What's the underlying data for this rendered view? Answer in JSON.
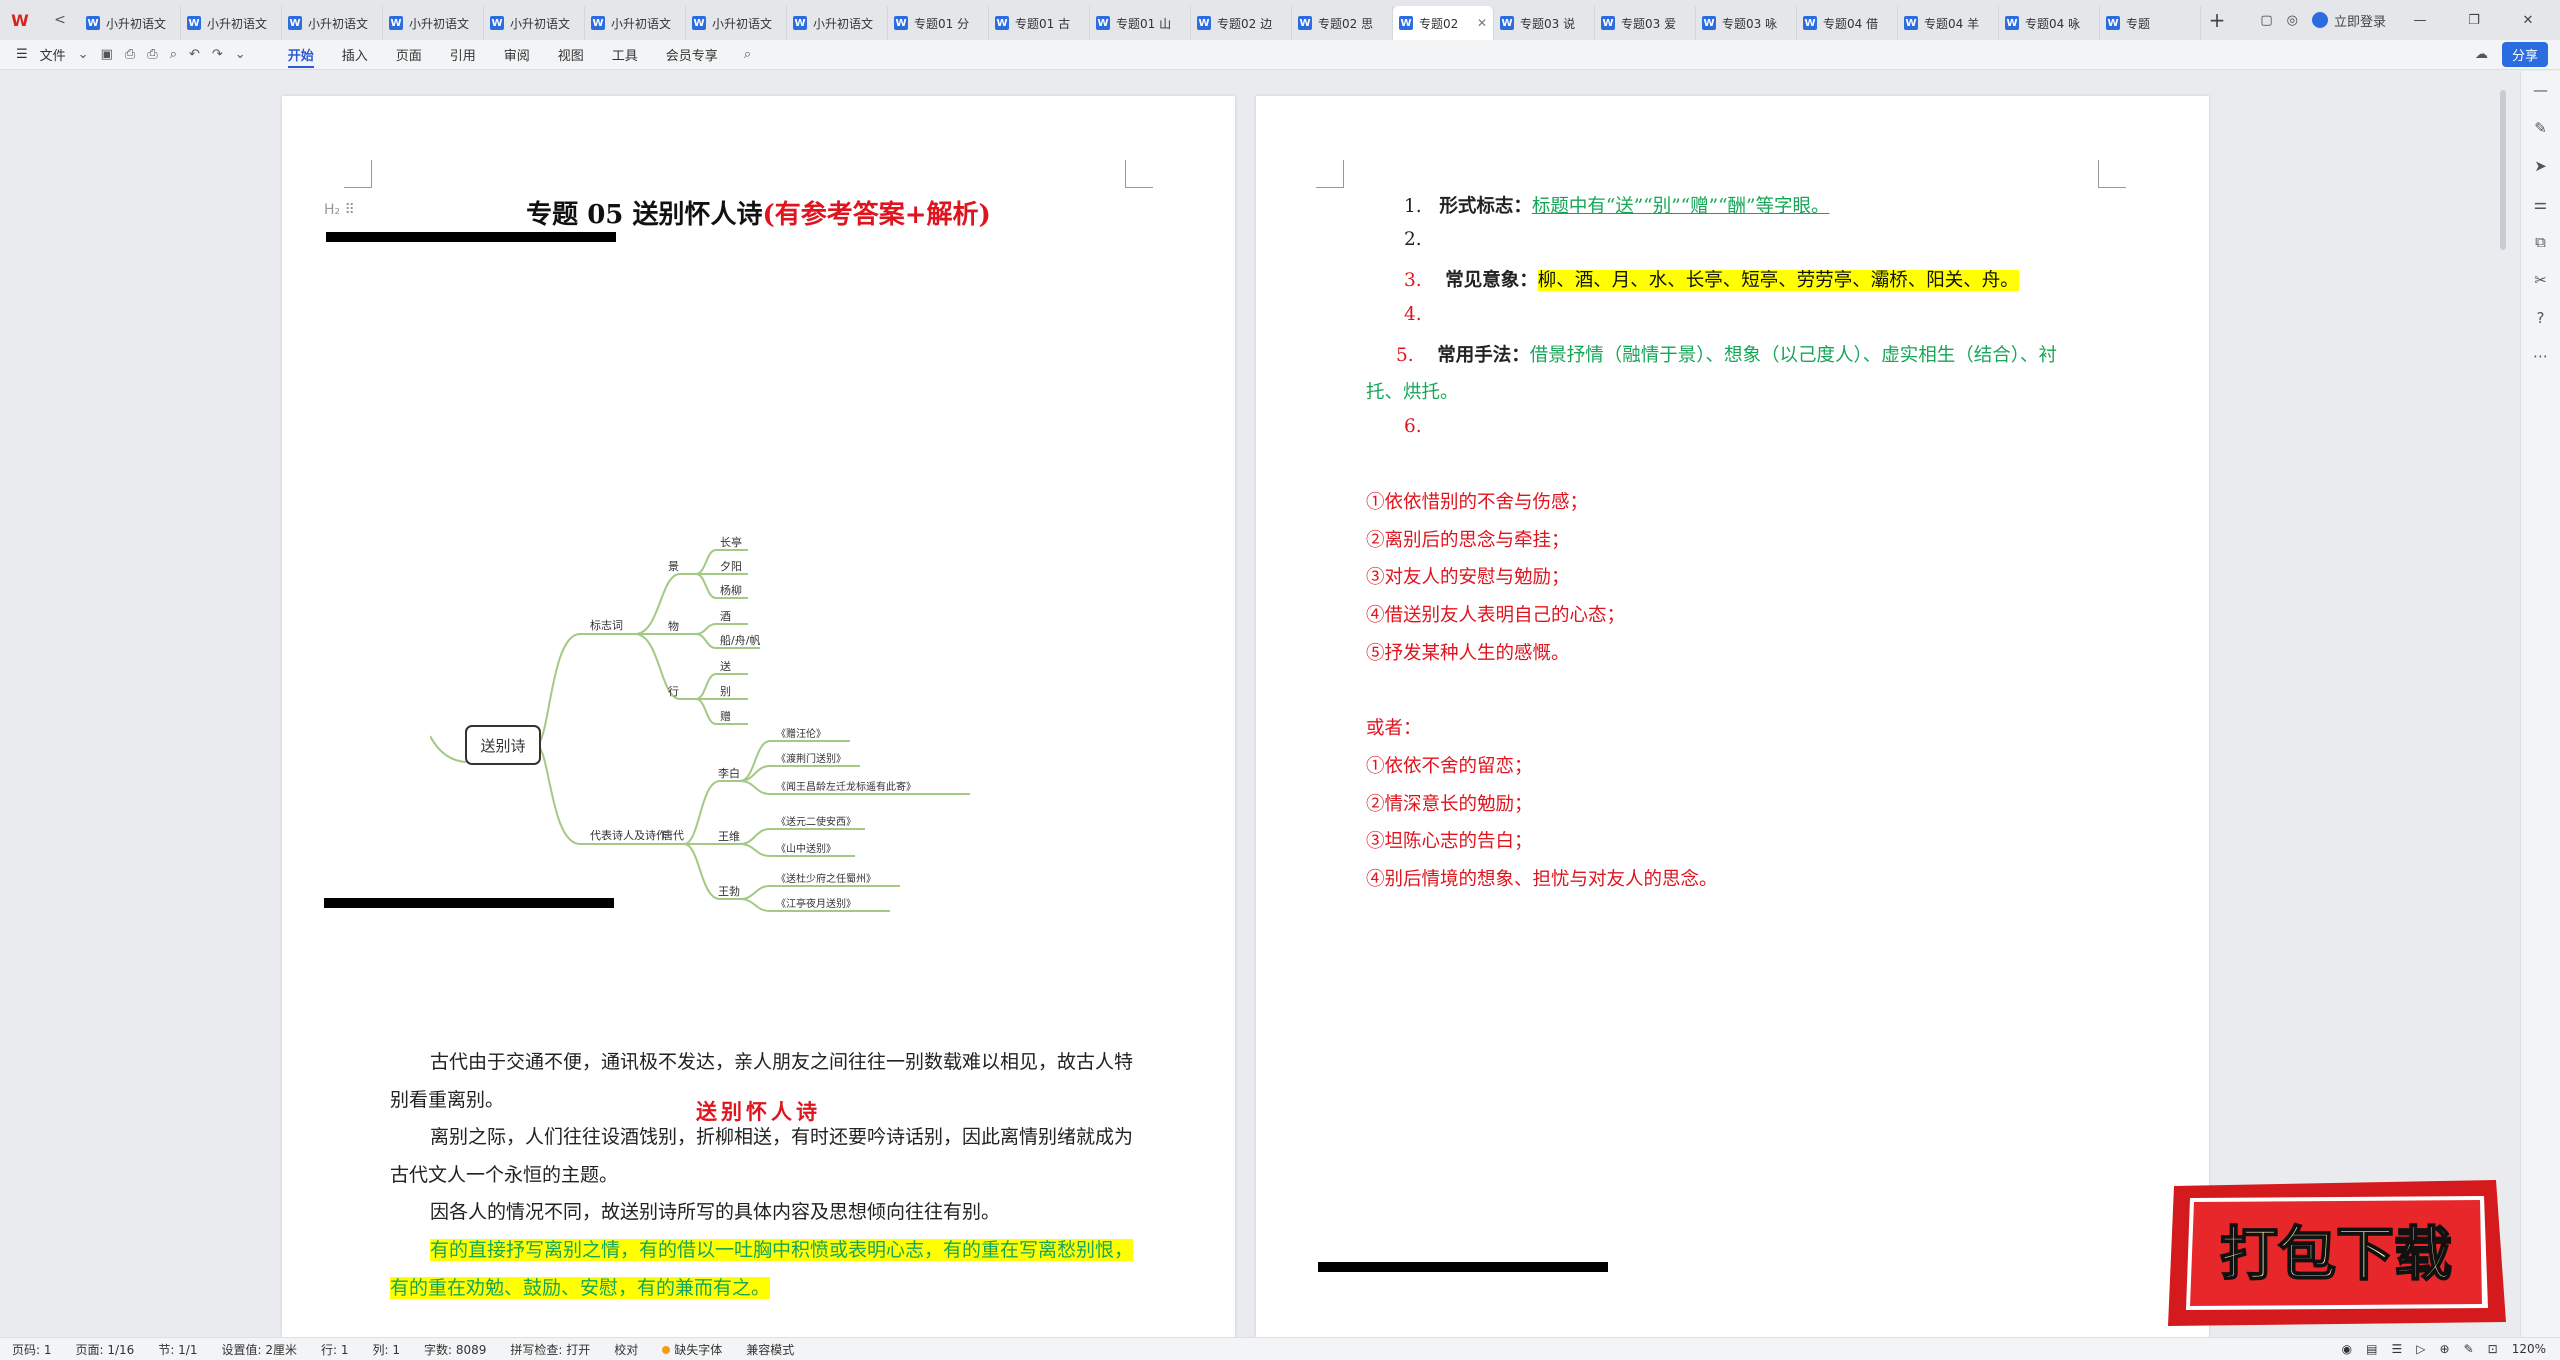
{
  "tabbar": {
    "logo": "W",
    "nav_back": "<",
    "tabs": [
      {
        "title": "小升初语文"
      },
      {
        "title": "小升初语文"
      },
      {
        "title": "小升初语文"
      },
      {
        "title": "小升初语文"
      },
      {
        "title": "小升初语文"
      },
      {
        "title": "小升初语文"
      },
      {
        "title": "小升初语文"
      },
      {
        "title": "小升初语文"
      },
      {
        "title": "专题01 分"
      },
      {
        "title": "专题01 古"
      },
      {
        "title": "专题01 山"
      },
      {
        "title": "专题02 边"
      },
      {
        "title": "专题02 思"
      },
      {
        "title": "专题02",
        "active": true
      },
      {
        "title": "专题03 说"
      },
      {
        "title": "专题03 爱"
      },
      {
        "title": "专题03 咏"
      },
      {
        "title": "专题04 借"
      },
      {
        "title": "专题04 羊"
      },
      {
        "title": "专题04 咏"
      },
      {
        "title": "专题"
      }
    ],
    "add": "+",
    "login_label": "立即登录",
    "win_min": "—",
    "win_max": "❐",
    "win_close": "✕"
  },
  "ribbon": {
    "file_label": "文件",
    "menu": [
      "开始",
      "插入",
      "页面",
      "引用",
      "审阅",
      "视图",
      "工具",
      "会员专享"
    ],
    "active_menu": "开始",
    "share_label": "分享"
  },
  "left_page": {
    "heading_mark": "H₂ ⠿",
    "title_main": "专题 05   送别怀人诗",
    "title_red": "(有参考答案+解析)",
    "section_title": "送别怀人诗",
    "paragraphs": [
      "古代由于交通不便，通讯极不发达，亲人朋友之间往往一别数载难以相见，故古人特别看重离别。",
      "离别之际，人们往往设酒饯别，折柳相送，有时还要吟诗话别，因此离情别绪就成为古代文人一个永恒的主题。",
      "因各人的情况不同，故送别诗所写的具体内容及思想倾向往往有别。"
    ],
    "highlight_paragraph": "有的直接抒写离别之情，有的借以一吐胸中积愤或表明心志，有的重在写离愁别恨，有的重在劝勉、鼓励、安慰，有的兼而有之。"
  },
  "mindmap": {
    "root": "送别诗",
    "branch1": "标志词",
    "branch1_children": [
      {
        "label": "景",
        "leaves": [
          "长亭",
          "夕阳",
          "杨柳"
        ]
      },
      {
        "label": "物",
        "leaves": [
          "酒",
          "船/舟/帆"
        ]
      },
      {
        "label": "行",
        "leaves": [
          "送",
          "别",
          "赠"
        ]
      }
    ],
    "branch2": "代表诗人及诗作",
    "era": "唐代",
    "poets": [
      {
        "label": "李白",
        "leaves": [
          "《赠汪伦》",
          "《渡荆门送别》",
          "《闻王昌龄左迁龙标遥有此寄》"
        ]
      },
      {
        "label": "王维",
        "leaves": [
          "《送元二使安西》",
          "《山中送别》"
        ]
      },
      {
        "label": "王勃",
        "leaves": [
          "《送杜少府之任蜀州》",
          "《江亭夜月送别》"
        ]
      }
    ]
  },
  "right_page": {
    "items": [
      {
        "num": "1.",
        "label": "形式标志：",
        "text": "标题中有“送”“别”“赠”“酬”等字眼。"
      },
      {
        "num": "2.",
        "label": "",
        "text": ""
      },
      {
        "num": "3.",
        "label": "常见意象：",
        "text": "柳、酒、月、水、长亭、短亭、劳劳亭、灞桥、阳关、舟。"
      },
      {
        "num": "4.",
        "label": "",
        "text": ""
      },
      {
        "num": "5.",
        "label": "常用手法：",
        "text": "借景抒情（融情于景）、想象（以己度人）、虚实相生（结合）、衬",
        "text_cont": "托、烘托。"
      },
      {
        "num": "6.",
        "label": "",
        "text": ""
      }
    ],
    "themes": [
      "①依依惜别的不舍与伤感；",
      "②离别后的思念与牵挂；",
      "③对友人的安慰与勉励；",
      "④借送别友人表明自己的心态；",
      "⑤抒发某种人生的感慨。"
    ],
    "or_label": "或者：",
    "themes_alt": [
      "①依依不舍的留恋；",
      "②情深意长的勉励；",
      "③坦陈心志的告白；",
      "④别后情境的想象、担忧与对友人的思念。"
    ]
  },
  "stamp": {
    "text": "打包下载"
  },
  "statusbar": {
    "page_code": "页码: 1",
    "page": "页面: 1/16",
    "section": "节: 1/1",
    "setting": "设置值: 2厘米",
    "row": "行: 1",
    "col": "列: 1",
    "words": "字数: 8089",
    "spell": "拼写检查: 打开",
    "proof": "校对",
    "missing_font": "缺失字体",
    "compat": "兼容模式",
    "zoom": "120%"
  },
  "colors": {
    "accent": "#2b6de1",
    "red": "#e0141e",
    "green": "#17a657",
    "highlight": "#ffff00"
  }
}
